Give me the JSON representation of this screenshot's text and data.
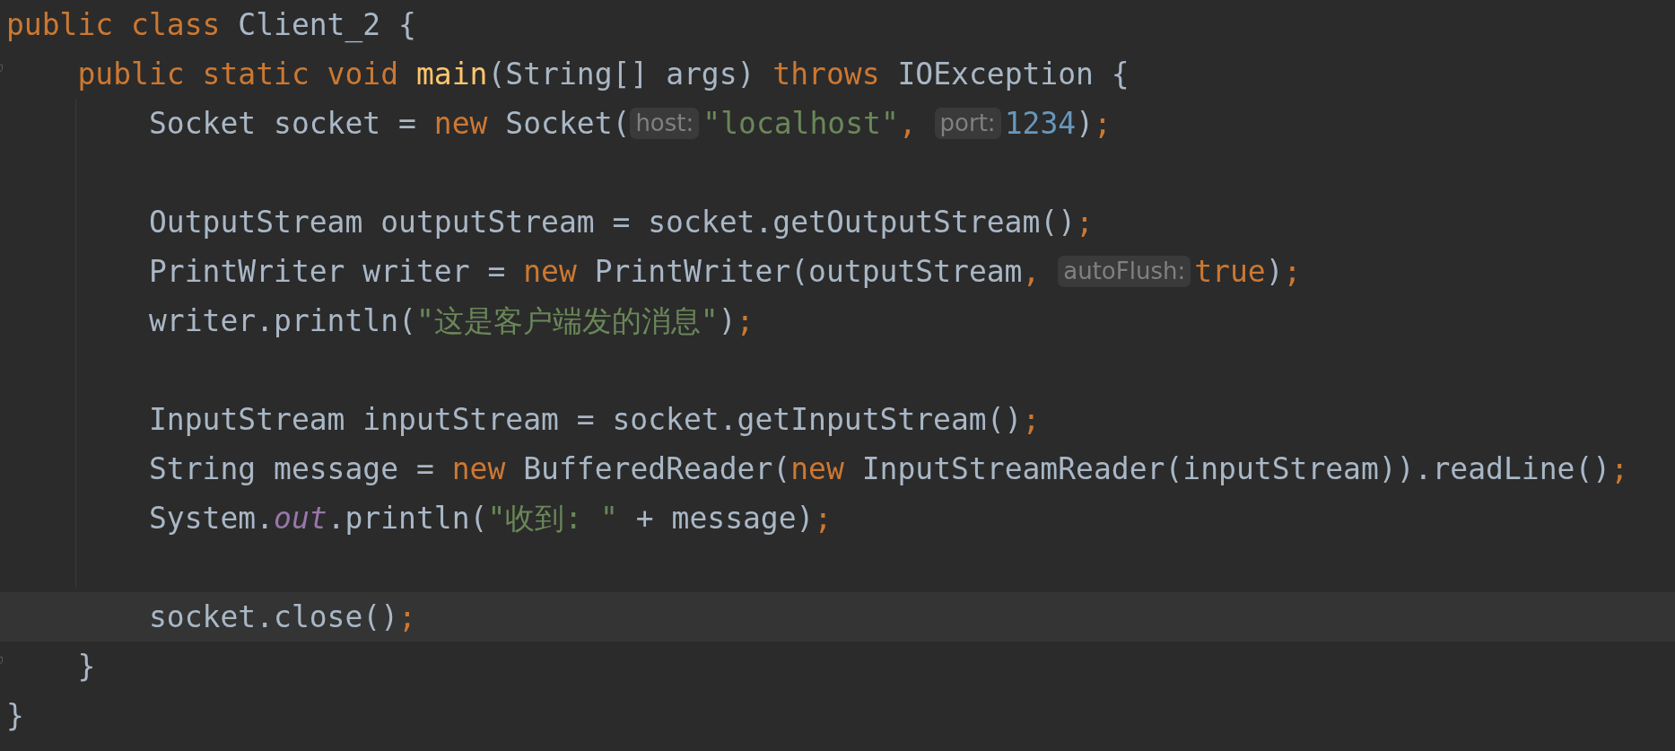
{
  "editor": {
    "lines": [
      {
        "current": false,
        "fold": false,
        "segments": [
          {
            "kind": "code",
            "tokens": [
              {
                "kind": "keyword",
                "text": "public class "
              },
              {
                "kind": "plain",
                "text": "Client_2 {"
              }
            ]
          }
        ]
      },
      {
        "current": false,
        "fold": true,
        "segments": [
          {
            "kind": "code",
            "tokens": [
              {
                "kind": "keyword",
                "text": "    public static void "
              },
              {
                "kind": "method",
                "text": "main"
              },
              {
                "kind": "plain",
                "text": "(String[] args) "
              },
              {
                "kind": "keyword",
                "text": "throws "
              },
              {
                "kind": "plain",
                "text": "IOException {"
              }
            ]
          }
        ]
      },
      {
        "current": false,
        "fold": false,
        "segments": [
          {
            "kind": "code",
            "tokens": [
              {
                "kind": "plain",
                "text": "        Socket socket = "
              },
              {
                "kind": "keyword",
                "text": "new "
              },
              {
                "kind": "plain",
                "text": "Socket("
              }
            ]
          },
          {
            "kind": "hint",
            "text": "host:"
          },
          {
            "kind": "code",
            "tokens": [
              {
                "kind": "string",
                "text": "\"localhost\""
              },
              {
                "kind": "keyword",
                "text": ", "
              }
            ]
          },
          {
            "kind": "hint",
            "text": "port:"
          },
          {
            "kind": "code",
            "tokens": [
              {
                "kind": "number",
                "text": "1234"
              },
              {
                "kind": "plain",
                "text": ")"
              },
              {
                "kind": "keyword",
                "text": ";"
              }
            ]
          }
        ]
      },
      {
        "current": false,
        "fold": false
      },
      {
        "current": false,
        "fold": false,
        "segments": [
          {
            "kind": "code",
            "tokens": [
              {
                "kind": "plain",
                "text": "        OutputStream outputStream = socket.getOutputStream()"
              },
              {
                "kind": "keyword",
                "text": ";"
              }
            ]
          }
        ]
      },
      {
        "current": false,
        "fold": false,
        "segments": [
          {
            "kind": "code",
            "tokens": [
              {
                "kind": "plain",
                "text": "        PrintWriter writer = "
              },
              {
                "kind": "keyword",
                "text": "new "
              },
              {
                "kind": "plain",
                "text": "PrintWriter(outputStream"
              },
              {
                "kind": "keyword",
                "text": ", "
              }
            ]
          },
          {
            "kind": "hint",
            "text": "autoFlush:"
          },
          {
            "kind": "code",
            "tokens": [
              {
                "kind": "keyword",
                "text": "true"
              },
              {
                "kind": "plain",
                "text": ")"
              },
              {
                "kind": "keyword",
                "text": ";"
              }
            ]
          }
        ]
      },
      {
        "current": false,
        "fold": false,
        "segments": [
          {
            "kind": "code",
            "tokens": [
              {
                "kind": "plain",
                "text": "        writer.println("
              },
              {
                "kind": "string",
                "text": "\"这是客户端发的消息\""
              },
              {
                "kind": "plain",
                "text": ")"
              },
              {
                "kind": "keyword",
                "text": ";"
              }
            ]
          }
        ]
      },
      {
        "current": false,
        "fold": false
      },
      {
        "current": false,
        "fold": false,
        "segments": [
          {
            "kind": "code",
            "tokens": [
              {
                "kind": "plain",
                "text": "        InputStream inputStream = socket.getInputStream()"
              },
              {
                "kind": "keyword",
                "text": ";"
              }
            ]
          }
        ]
      },
      {
        "current": false,
        "fold": false,
        "segments": [
          {
            "kind": "code",
            "tokens": [
              {
                "kind": "plain",
                "text": "        String message = "
              },
              {
                "kind": "keyword",
                "text": "new "
              },
              {
                "kind": "plain",
                "text": "BufferedReader("
              },
              {
                "kind": "keyword",
                "text": "new "
              },
              {
                "kind": "plain",
                "text": "InputStreamReader(inputStream)).readLine()"
              },
              {
                "kind": "keyword",
                "text": ";"
              }
            ]
          }
        ]
      },
      {
        "current": false,
        "fold": false,
        "segments": [
          {
            "kind": "code",
            "tokens": [
              {
                "kind": "plain",
                "text": "        System."
              },
              {
                "kind": "field",
                "text": "out"
              },
              {
                "kind": "plain",
                "text": ".println("
              },
              {
                "kind": "string",
                "text": "\"收到: \""
              },
              {
                "kind": "plain",
                "text": " + message)"
              },
              {
                "kind": "keyword",
                "text": ";"
              }
            ]
          }
        ]
      },
      {
        "current": false,
        "fold": false
      },
      {
        "current": true,
        "fold": false,
        "segments": [
          {
            "kind": "code",
            "tokens": [
              {
                "kind": "plain",
                "text": "        socket.close()"
              },
              {
                "kind": "keyword",
                "text": ";"
              }
            ]
          }
        ]
      },
      {
        "current": false,
        "fold": true,
        "segments": [
          {
            "kind": "code",
            "tokens": [
              {
                "kind": "plain",
                "text": "    }"
              }
            ]
          }
        ]
      },
      {
        "current": false,
        "fold": false,
        "segments": [
          {
            "kind": "code",
            "tokens": [
              {
                "kind": "plain",
                "text": "}"
              }
            ]
          }
        ]
      }
    ]
  }
}
